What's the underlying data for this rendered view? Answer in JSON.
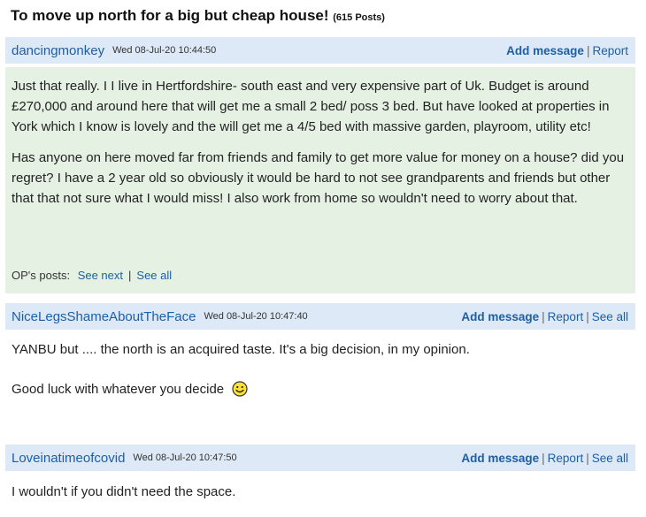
{
  "thread": {
    "title": "To move up north for a big but cheap house!",
    "post_count": "(615 Posts)"
  },
  "actions": {
    "add_message": "Add message",
    "report": "Report",
    "see_all": "See all",
    "separator": "|"
  },
  "posts": [
    {
      "username": "dancingmonkey",
      "timestamp": "Wed 08-Jul-20 10:44:50",
      "paragraphs": [
        "Just that really. I I live in Hertfordshire- south east and very expensive part of Uk. Budget is around £270,000 and around here that will get me a small 2 bed/ poss 3 bed. But have looked at properties in York which I know is lovely and the will get me a 4/5 bed with massive garden, playroom, utility etc!",
        "Has anyone on here moved far from friends and family to get more value for money on a house? did you regret? I have a 2 year old so obviously it would be hard to not see grandparents and friends but other that that not sure what I would miss! I also work from home so wouldn't need to worry about that."
      ],
      "op_posts_label": "OP's posts:",
      "see_next": "See next",
      "see_all": "See all"
    },
    {
      "username": "NiceLegsShameAboutTheFace",
      "timestamp": "Wed 08-Jul-20 10:47:40",
      "paragraphs": [
        "YANBU but .... the north is an acquired taste. It's a big decision, in my opinion.",
        "Good luck with whatever you decide"
      ],
      "emoji": "smiley-icon"
    },
    {
      "username": "Loveinatimeofcovid",
      "timestamp": "Wed 08-Jul-20 10:47:50",
      "paragraphs": [
        "I wouldn't if you didn't need the space."
      ]
    }
  ],
  "colors": {
    "header_bg": "#dde9f6",
    "op_bg": "#e5f2e3",
    "link": "#1c5fa8"
  }
}
